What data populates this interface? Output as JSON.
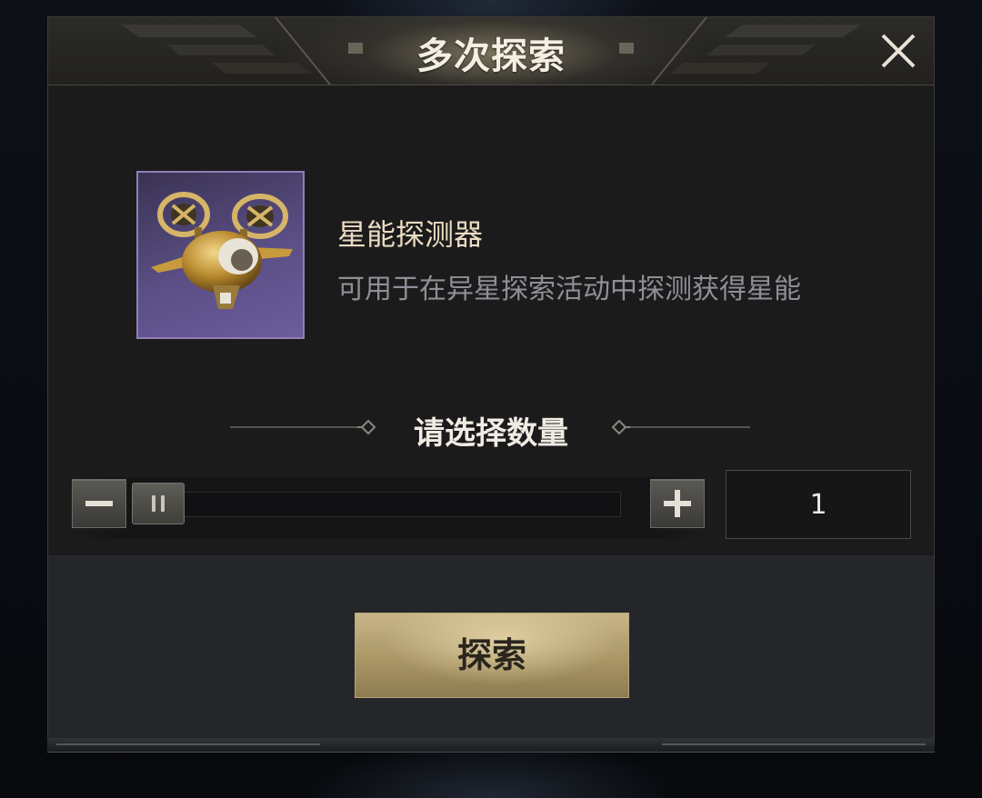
{
  "dialog": {
    "title": "多次探索",
    "close_icon": "close-icon"
  },
  "item": {
    "icon": "drone-probe-icon",
    "name": "星能探测器",
    "description": "可用于在异星探索活动中探测获得星能"
  },
  "quantity": {
    "heading": "请选择数量",
    "value": "1",
    "slider_fraction": 0,
    "minus_icon": "minus-icon",
    "plus_icon": "plus-icon"
  },
  "actions": {
    "explore_label": "探索"
  },
  "colors": {
    "panel": "#1c1b1c",
    "footer": "#24262a",
    "gold_button": "#b9a676",
    "item_frame": "#8e7fb6",
    "title_text": "#f4efe3",
    "item_name_text": "#eadcc2",
    "desc_text": "#8d9096"
  }
}
